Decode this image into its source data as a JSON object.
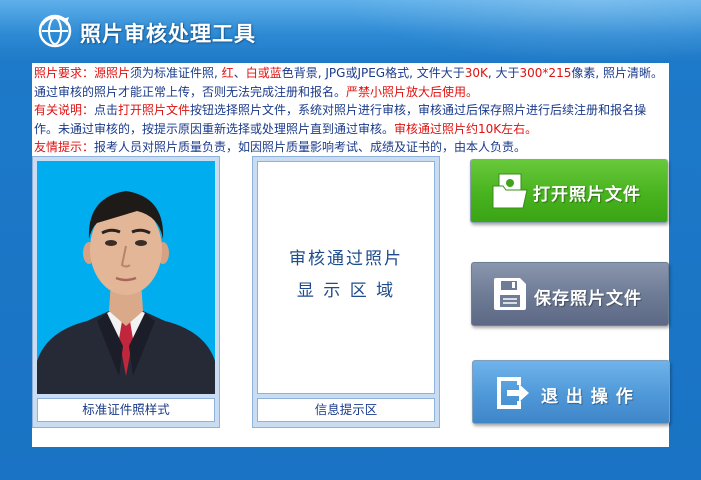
{
  "app": {
    "title": "照片审核处理工具",
    "colors": {
      "titlebar": "#2d8ad4",
      "accent_red": "#e01010",
      "text_blue": "#1a3a8a"
    }
  },
  "notice": {
    "req_label": "照片要求：",
    "req_src": "源照片",
    "req_t1": "须为标准证件照, ",
    "req_red": "红",
    "req_sep1": "、",
    "req_white": "白",
    "req_or": "或",
    "req_blue": "蓝",
    "req_t2": "色背景, JPG或JPEG格式, 文件大于",
    "req_size1": "30K",
    "req_t3": ", 大于",
    "req_size2": "300*215",
    "req_t4": "像素, 照片",
    "req_t5": "清晰。通过审核的照片才能正常上传，否则无法完成注册和报名。",
    "req_warn": "严禁小照片放大后使用。",
    "info_label": "有关说明：",
    "info_t1": "点击",
    "info_btn": "打开照片文件",
    "info_t2": "按钮选择照片文件，系统对照片进行审核，审核通过后保存照片进行后续注册",
    "info_t3": "和报名操作。未通过审核的，按提示原因重新选择或处理照片直到通过审核。",
    "info_red": "审核通过照片约10K左右。",
    "tip_label": "友情提示：",
    "tip_text": "报考人员对照片质量负责，如因照片质量影响考试、成绩及证书的，由本人负责。"
  },
  "sample": {
    "caption": "标准证件照样式"
  },
  "result": {
    "line1": "审核通过照片",
    "line2": "显 示 区 域",
    "caption": "信息提示区"
  },
  "buttons": {
    "open": {
      "label": "打开照片文件",
      "icon": "open-photo-icon"
    },
    "save": {
      "label": "保存照片文件",
      "icon": "floppy-disk-icon"
    },
    "exit": {
      "label": "退 出 操 作",
      "icon": "exit-arrow-icon"
    }
  }
}
